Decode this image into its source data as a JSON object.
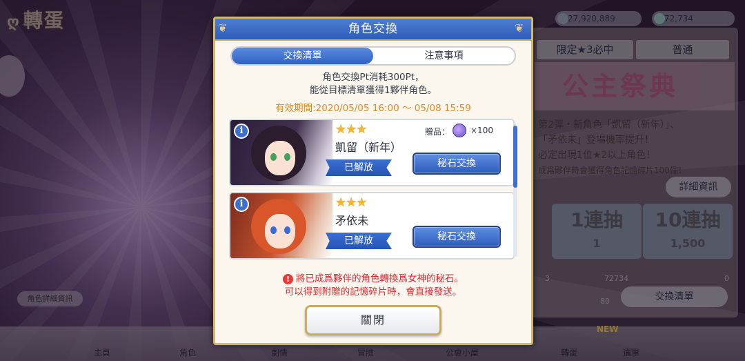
{
  "background": {
    "title": "轉蛋",
    "currency_1": "27,920,889",
    "currency_2": "72,734",
    "tabs": [
      "限定★3必中",
      "普通"
    ],
    "banner": "公主祭典",
    "lines": [
      "第2彈・新角色「凱留（新年）」、",
      "「矛依未」登場機率提升！",
      "必定出現1位★2以上角色！",
      "成爲夥伴時會獲得角色記憶碎片100個！"
    ],
    "details_button": "詳細資訊",
    "gacha_1_title": "1連抽",
    "gacha_1_cost": "1",
    "gacha_10_title": "10連抽",
    "gacha_10_cost": "1,500",
    "pt_left": "3",
    "pt_right": "72734",
    "pt_zero": "0",
    "pt_bar": "80",
    "exchange_list_button": "交換清單",
    "chip": "角色詳細資訊",
    "nav": [
      "主頁",
      "角色",
      "劇情",
      "冒險",
      "公會小屋",
      "轉蛋",
      "選單"
    ],
    "nav_new": "NEW"
  },
  "modal": {
    "title": "角色交換",
    "tabs": {
      "exchange_list": "交換清單",
      "notes": "注意事項"
    },
    "description_line1": "角色交換Pt消耗300Pt，",
    "description_line2": "能從目標清單獲得1夥伴角色。",
    "period": "有效期間:2020/05/05 16:00 ～ 05/08 15:59",
    "items": [
      {
        "stars": "★★★",
        "name": "凱留（新年）",
        "status": "已解放",
        "gift_label": "贈品：",
        "gift_qty": "×100",
        "button": "秘石交換"
      },
      {
        "stars": "★★★",
        "name": "矛依未",
        "status": "已解放",
        "button": "秘石交換"
      }
    ],
    "warning_line1": "將已成爲夥伴的角色轉換爲女神的秘石。",
    "warning_line2": "可以得到附贈的記憶碎片時，會直接發送。",
    "close": "關閉"
  },
  "colors": {
    "header_blue": "#2c5db8",
    "gold_border": "#d6b86a",
    "period_orange": "#e08a1e",
    "warning_red": "#e0262e"
  }
}
